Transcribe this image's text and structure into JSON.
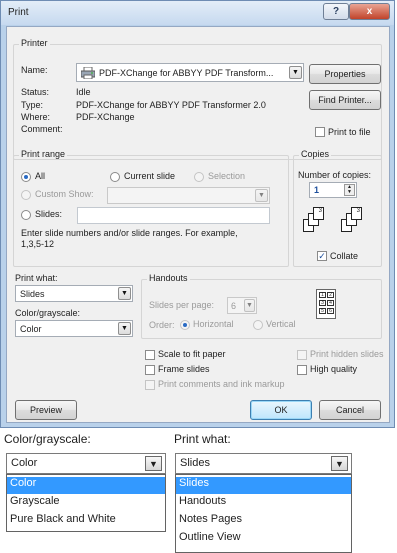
{
  "window": {
    "title": "Print",
    "help_glyph": "?",
    "close_glyph": "x"
  },
  "printer": {
    "group_label": "Printer",
    "name_label": "Name:",
    "name_value": "PDF-XChange for ABBYY PDF Transform...",
    "properties_button": "Properties",
    "find_printer_button": "Find Printer...",
    "status_label": "Status:",
    "status_value": "Idle",
    "type_label": "Type:",
    "type_value": "PDF-XChange for ABBYY PDF Transformer 2.0",
    "where_label": "Where:",
    "where_value": "PDF-XChange",
    "comment_label": "Comment:",
    "comment_value": "",
    "print_to_file_label": "Print to file"
  },
  "print_range": {
    "group_label": "Print range",
    "all_label": "All",
    "current_slide_label": "Current slide",
    "selection_label": "Selection",
    "custom_show_label": "Custom Show:",
    "slides_label": "Slides:",
    "hint_line1": "Enter slide numbers and/or slide ranges. For example,",
    "hint_line2": "1,3,5-12"
  },
  "copies": {
    "group_label": "Copies",
    "number_label": "Number of copies:",
    "number_value": "1",
    "collate_label": "Collate",
    "collate_checked": true
  },
  "print_what": {
    "label": "Print what:",
    "value": "Slides"
  },
  "color_grayscale": {
    "label": "Color/grayscale:",
    "value": "Color"
  },
  "handouts": {
    "group_label": "Handouts",
    "slides_per_page_label": "Slides per page:",
    "slides_per_page_value": "6",
    "order_label": "Order:",
    "horizontal_label": "Horizontal",
    "vertical_label": "Vertical"
  },
  "options": {
    "scale_to_fit": "Scale to fit paper",
    "frame_slides": "Frame slides",
    "print_comments": "Print comments and ink markup",
    "print_hidden": "Print hidden slides",
    "high_quality": "High quality"
  },
  "footer": {
    "preview_button": "Preview",
    "ok_button": "OK",
    "cancel_button": "Cancel"
  },
  "color_dropdown": {
    "label": "Color/grayscale:",
    "value": "Color",
    "options": [
      "Color",
      "Grayscale",
      "Pure Black and White"
    ],
    "selected_index": 0
  },
  "print_what_dropdown": {
    "label": "Print what:",
    "value": "Slides",
    "options": [
      "Slides",
      "Handouts",
      "Notes Pages",
      "Outline View"
    ],
    "selected_index": 0
  },
  "colors": {
    "selection": "#3399ff",
    "title_bar": "#c6d9ef",
    "close_button": "#c1432a"
  },
  "icons": [
    "printer-icon",
    "help-icon",
    "close-icon",
    "collate-icon",
    "dropdown-arrow-icon"
  ]
}
